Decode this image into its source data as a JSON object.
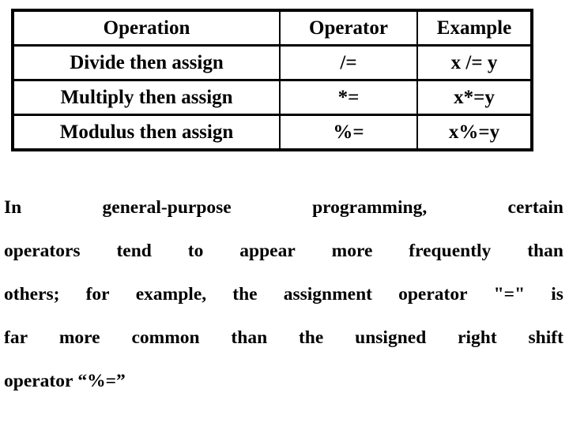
{
  "slide": {
    "background_color": "#ffffff",
    "text_color": "#000000"
  },
  "table": {
    "name": "compound-assignment-operators-table",
    "border_color": "#000000",
    "headers": {
      "operation": "Operation",
      "operator": "Operator",
      "example": "Example"
    },
    "rows": [
      {
        "operation": "Divide then assign",
        "operator": "/=",
        "example": "x /= y"
      },
      {
        "operation": "Multiply then assign",
        "operator": "*=",
        "example": "x*=y"
      },
      {
        "operation": "Modulus then assign",
        "operator": "%=",
        "example": "x%=y"
      }
    ]
  },
  "paragraph": {
    "full_text": "In general-purpose programming, certain operators tend to appear more frequently than others; for example, the assignment operator \"=\" is far more common than the unsigned right shift operator “%=”",
    "lines": [
      {
        "align": "justify",
        "words": [
          "In",
          "general-purpose",
          "programming,",
          "certain"
        ]
      },
      {
        "align": "justify",
        "words": [
          "operators",
          "tend",
          "to",
          "appear",
          "more",
          "frequently",
          "than"
        ]
      },
      {
        "align": "justify",
        "words": [
          "others;",
          "for",
          "example,",
          "the",
          "assignment",
          "operator",
          "\"=\"",
          "is"
        ]
      },
      {
        "align": "justify",
        "words": [
          "far",
          "more",
          "common",
          "than",
          "the",
          "unsigned",
          "right",
          "shift"
        ]
      },
      {
        "align": "left",
        "words": [
          "operator",
          "“%=”"
        ]
      }
    ]
  }
}
